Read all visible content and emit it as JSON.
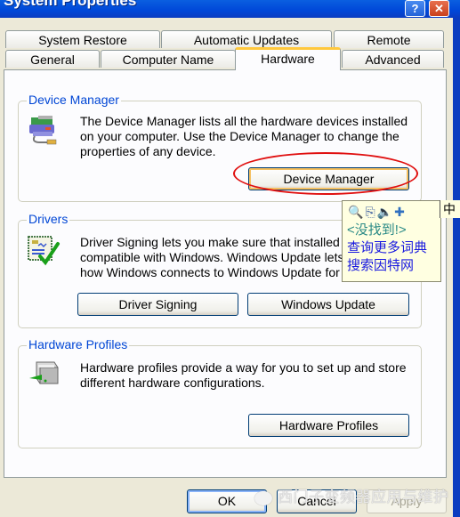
{
  "window": {
    "title": "System Properties",
    "help_label": "?",
    "close_label": "✕"
  },
  "tabs": {
    "row1": [
      {
        "label": "System Restore"
      },
      {
        "label": "Automatic Updates"
      },
      {
        "label": "Remote"
      }
    ],
    "row2": [
      {
        "label": "General"
      },
      {
        "label": "Computer Name"
      },
      {
        "label": "Hardware",
        "active": true
      },
      {
        "label": "Advanced"
      }
    ]
  },
  "groups": {
    "device_manager": {
      "label": "Device Manager",
      "text": "The Device Manager lists all the hardware devices installed on your computer. Use the Device Manager to change the properties of any device.",
      "button": "Device Manager",
      "icon": "device-manager-icon"
    },
    "drivers": {
      "label": "Drivers",
      "text": "Driver Signing lets you make sure that installed drivers are compatible with Windows. Windows Update lets you set up how Windows connects to Windows Update for drivers.",
      "visible_text_lines": [
        "Driver Signing lets you make sure that installed dri",
        "compatible with Windows. Windows Update lets y",
        "how Windows connects to Windows Update for d"
      ],
      "buttons": [
        "Driver Signing",
        "Windows Update"
      ],
      "icon": "driver-signing-icon"
    },
    "hardware_profiles": {
      "label": "Hardware Profiles",
      "text": "Hardware profiles provide a way for you to set up and store different hardware configurations.",
      "button": "Hardware Profiles",
      "icon": "hardware-profiles-icon"
    }
  },
  "dialog_buttons": {
    "ok": "OK",
    "cancel": "Cancel",
    "apply": "Apply"
  },
  "dictionary_popup": {
    "icons": [
      "search-icon",
      "copy-icon",
      "speaker-icon",
      "add-word-icon"
    ],
    "not_found": "<没找到!>",
    "query_more": "查询更多词典",
    "search_web": "搜索因特网",
    "ime_indicator": "中"
  },
  "watermark": {
    "text": "西门子变频器应用与维护"
  },
  "colors": {
    "titlebar": "#0047d8",
    "group_label": "#0046d5",
    "active_tab_accent": "#ffc83c",
    "annotation_ellipse": "#e01010",
    "popup_bg": "#ffffe1"
  }
}
